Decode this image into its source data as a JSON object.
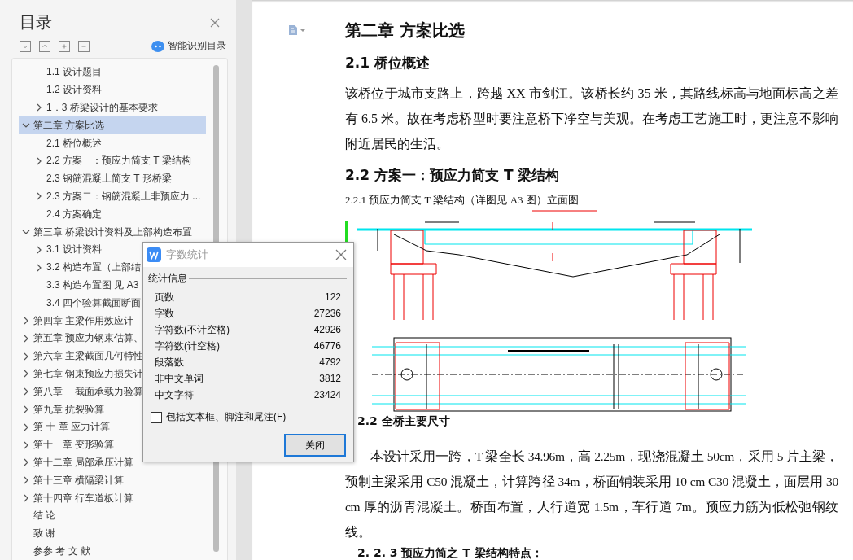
{
  "sidebar": {
    "title": "目录",
    "smart_toc_label": "智能识别目录",
    "leading_items": [
      {
        "label": "1.1 设计题目",
        "selected": false
      },
      {
        "label": "1.2  设计资料",
        "selected": false
      },
      {
        "label": "1．3  桥梁设计的基本要求",
        "selected": false,
        "expanded": false
      }
    ],
    "items": [
      {
        "label": "第二章  方案比选",
        "selected": true,
        "expanded": true,
        "children": [
          {
            "label": "2.1 桥位概述",
            "selected": false
          },
          {
            "label": "2.2  方案一：预应力简支 T 梁结构",
            "selected": false,
            "expanded": false
          },
          {
            "label": "2.3  钢筋混凝土简支 T 形桥梁",
            "selected": false
          },
          {
            "label": "2.3  方案二：钢筋混凝土非预应力 ...",
            "selected": false,
            "expanded": false
          },
          {
            "label": "2.4  方案确定",
            "selected": false
          }
        ]
      },
      {
        "label": "第三章  桥梁设计资料及上部构造布置",
        "selected": false,
        "expanded": true,
        "children": [
          {
            "label": "3.1 设计资料",
            "selected": false,
            "expanded": false
          },
          {
            "label": "3.2 构造布置（上部结",
            "selected": false,
            "expanded": false
          },
          {
            "label": "3.3 构造布置图  见 A3",
            "selected": false
          },
          {
            "label": "3.4  四个验算截面断面",
            "selected": false
          }
        ]
      },
      {
        "label": "第四章  主梁作用效应计",
        "selected": false,
        "expanded": false
      },
      {
        "label": "第五章  预应力钢束估算、",
        "selected": false,
        "expanded": false
      },
      {
        "label": "第六章  主梁截面几何特性",
        "selected": false,
        "expanded": false
      },
      {
        "label": "第七章  钢束预应力损失计",
        "selected": false,
        "expanded": false
      },
      {
        "label": "第八章　 截面承载力验算",
        "selected": false,
        "expanded": false
      },
      {
        "label": "第九章  抗裂验算",
        "selected": false,
        "expanded": false
      },
      {
        "label": "第  十  章  应力计算",
        "selected": false,
        "expanded": false
      },
      {
        "label": "第十一章  变形验算",
        "selected": false,
        "expanded": false
      },
      {
        "label": "第十二章  局部承压计算",
        "selected": false,
        "expanded": false
      },
      {
        "label": "第十三章  横隔梁计算",
        "selected": false,
        "expanded": false
      },
      {
        "label": "第十四章  行车道板计算",
        "selected": false,
        "expanded": false
      },
      {
        "label": "结    论",
        "selected": false
      },
      {
        "label": "致    谢",
        "selected": false
      },
      {
        "label": "参参  考  文  献",
        "selected": false
      }
    ]
  },
  "document": {
    "blocks": [
      {
        "kind": "h1",
        "text": "第二章  方案比选"
      },
      {
        "kind": "h2",
        "text": "2.1 桥位概述"
      },
      {
        "kind": "p",
        "text": "该桥位于城市支路上，跨越 XX 市剑江。该桥长约 35 米，其路线标高与地面标高之差有 6.5 米。故在考虑桥型时要注意桥下净空与美观。在考虑工艺施工时，更注意不影响附近居民的生活。"
      },
      {
        "kind": "h2",
        "text": "2.2  方案一：预应力简支 T 梁结构"
      },
      {
        "kind": "caption",
        "text": "2.2.1 预应力简支 T 梁结构（详图见 A3 图）立面图"
      },
      {
        "kind": "drawing"
      },
      {
        "kind": "h3",
        "text": "2.2  全桥主要尺寸"
      },
      {
        "kind": "pi",
        "text": "本设计采用一跨，T 梁全长 34.96m，高 2.25m，现浇混凝土 50cm，采用 5 片主梁，预制主梁采用 C50 混凝土，计算跨径 34m，桥面铺装采用 10 cm C30 混凝土，面层用 30 cm 厚的沥青混凝土。桥面布置，人行道宽 1.5m，车行道 7m。预应力筋为低松弛钢纹线。"
      },
      {
        "kind": "h3",
        "text": "2. 2. 3 预应力简之 T 梁结构特点："
      }
    ]
  },
  "dialog": {
    "title": "字数统计",
    "group": "统计信息",
    "rows": [
      {
        "label": "页数",
        "value": "122"
      },
      {
        "label": "字数",
        "value": "27236"
      },
      {
        "label": "字符数(不计空格)",
        "value": "42926"
      },
      {
        "label": "字符数(计空格)",
        "value": "46776"
      },
      {
        "label": "段落数",
        "value": "4792"
      },
      {
        "label": "非中文单词",
        "value": "3812"
      },
      {
        "label": "中文字符",
        "value": "23424"
      }
    ],
    "checkbox": {
      "label": "包括文本框、脚注和尾注(F)",
      "checked": false
    },
    "button": "关闭"
  }
}
